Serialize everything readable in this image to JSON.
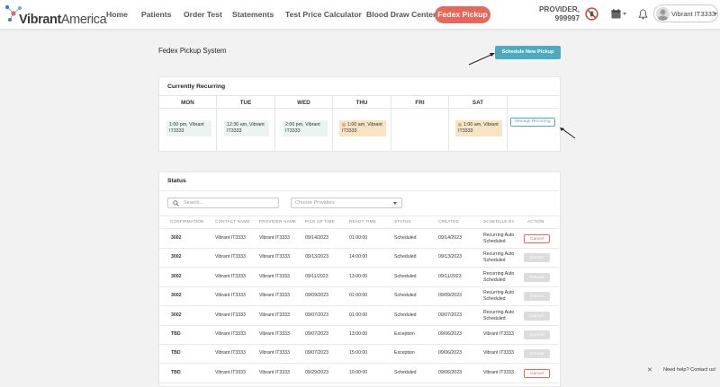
{
  "header": {
    "logo": {
      "prefix": "Vibrant",
      "suffix": "America"
    },
    "nav": [
      {
        "label": "Home",
        "name": "nav-home"
      },
      {
        "label": "Patients",
        "name": "nav-patients"
      },
      {
        "label": "Order Test",
        "name": "nav-order-test"
      },
      {
        "label": "Statements",
        "name": "nav-statements"
      },
      {
        "label": "Test Price Calculator",
        "name": "nav-test-price-calculator"
      },
      {
        "label": "Blood Draw Center",
        "name": "nav-blood-draw-center"
      }
    ],
    "active_nav": "Fedex Pickup",
    "provider_line1": "PROVIDER,",
    "provider_line2": "999997",
    "user_name": "Vibrant IT3333",
    "icons": [
      "no-sign-icon",
      "calendar-icon",
      "bell-icon",
      "avatar"
    ]
  },
  "page": {
    "title": "Fedex Pickup System",
    "schedule_button": "Schedule New Pickup"
  },
  "recurring": {
    "title": "Currently Recurring",
    "days": [
      "MON",
      "TUE",
      "WED",
      "THU",
      "FRI",
      "SAT"
    ],
    "slots": [
      {
        "line1": "1:00 pm, Vibrant",
        "line2": "IT3333",
        "style": "green"
      },
      {
        "line1": "12:30 am, Vibrant",
        "line2": "IT3333",
        "style": "green"
      },
      {
        "line1": "2:00 pm, Vibrant",
        "line2": "IT3333",
        "style": "green"
      },
      {
        "line1": "1:00 am, Vibrant",
        "line2": "IT3333",
        "style": "orange"
      },
      null,
      {
        "line1": "1:00 am, Vibrant",
        "line2": "IT3333",
        "style": "orange"
      }
    ],
    "manage_button": "Manage Recurring"
  },
  "status": {
    "title": "Status",
    "search_placeholder": "Search...",
    "provider_placeholder": "Choose Providers",
    "columns": [
      "CONFIRMATION",
      "CONTACT NAME",
      "PROVIDER NAME",
      "PICK UP TIME",
      "READY TIME",
      "STATUS",
      "CREATED",
      "SCHEDULE BY",
      "ACTION"
    ],
    "rows": [
      {
        "confirmation": "3002",
        "contact": "Vibrant IT3333",
        "provider": "Vibrant IT3333",
        "pickup": "09/14/2023",
        "ready": "01:00:00",
        "status": "Scheduled",
        "created": "09/14/2023",
        "schedule_by": "Recurring Auto Scheduled",
        "action": "Cancel",
        "enabled": true
      },
      {
        "confirmation": "3002",
        "contact": "Vibrant IT3333",
        "provider": "Vibrant IT3333",
        "pickup": "09/13/2023",
        "ready": "14:00:00",
        "status": "Scheduled",
        "created": "09/13/2023",
        "schedule_by": "Recurring Auto Scheduled",
        "action": "Cancel",
        "enabled": false
      },
      {
        "confirmation": "3002",
        "contact": "Vibrant IT3333",
        "provider": "Vibrant IT3333",
        "pickup": "09/11/2023",
        "ready": "13:00:00",
        "status": "Scheduled",
        "created": "09/11/2023",
        "schedule_by": "Recurring Auto Scheduled",
        "action": "Cancel",
        "enabled": false
      },
      {
        "confirmation": "3002",
        "contact": "Vibrant IT3333",
        "provider": "Vibrant IT3333",
        "pickup": "09/09/2023",
        "ready": "01:00:00",
        "status": "Scheduled",
        "created": "09/09/2023",
        "schedule_by": "Recurring Auto Scheduled",
        "action": "Cancel",
        "enabled": false
      },
      {
        "confirmation": "3002",
        "contact": "Vibrant IT3333",
        "provider": "Vibrant IT3333",
        "pickup": "09/07/2023",
        "ready": "01:00:00",
        "status": "Scheduled",
        "created": "09/07/2023",
        "schedule_by": "Recurring Auto Scheduled",
        "action": "Cancel",
        "enabled": false
      },
      {
        "confirmation": "TBD",
        "contact": "Vibrant IT3333",
        "provider": "Vibrant IT3333",
        "pickup": "09/07/2023",
        "ready": "13:00:00",
        "status": "Exception",
        "created": "09/06/2023",
        "schedule_by": "Vibrant IT3333",
        "action": "Cancel",
        "enabled": false
      },
      {
        "confirmation": "TBD",
        "contact": "Vibrant IT3333",
        "provider": "Vibrant IT3333",
        "pickup": "09/07/2023",
        "ready": "15:00:00",
        "status": "Exception",
        "created": "09/06/2023",
        "schedule_by": "Vibrant IT3333",
        "action": "Cancel",
        "enabled": false
      },
      {
        "confirmation": "TBD",
        "contact": "Vibrant IT3333",
        "provider": "Vibrant IT3333",
        "pickup": "09/29/2023",
        "ready": "10:00:00",
        "status": "Scheduled",
        "created": "09/06/2023",
        "schedule_by": "Vibrant IT3333",
        "action": "Cancel",
        "enabled": true
      }
    ]
  },
  "help": {
    "label": "Need help? Contact us!"
  }
}
